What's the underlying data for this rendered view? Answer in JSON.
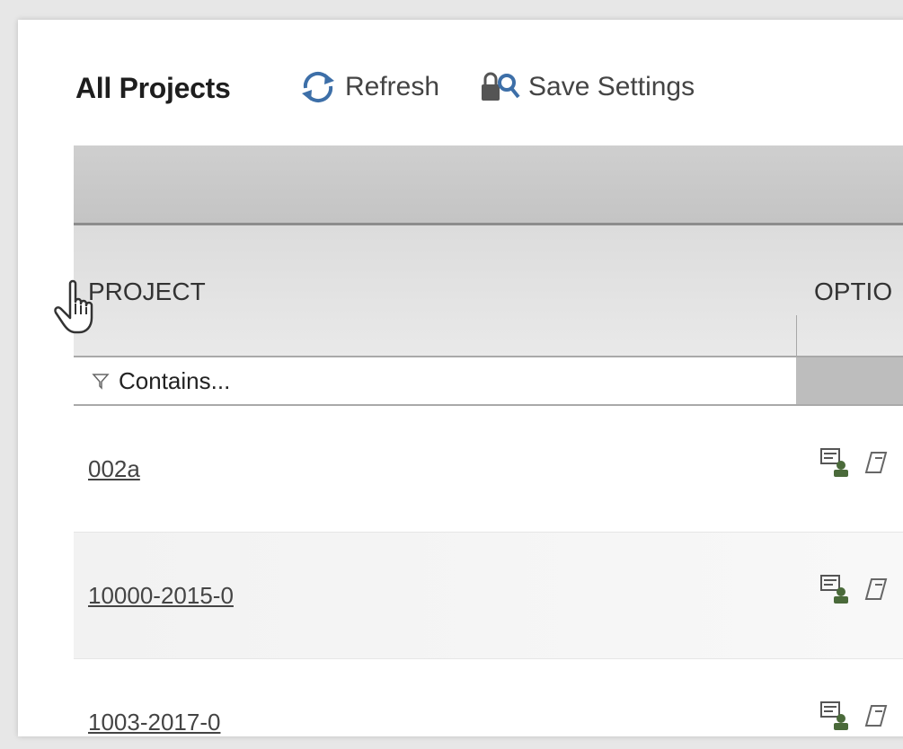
{
  "toolbar": {
    "title": "All Projects",
    "refresh_label": "Refresh",
    "refresh_icon": "refresh-icon",
    "save_label": "Save Settings",
    "save_icon": "save-settings-icon"
  },
  "grid": {
    "columns": [
      {
        "key": "project",
        "label": "PROJECT"
      },
      {
        "key": "options",
        "label": "OPTIO"
      }
    ],
    "filter": {
      "placeholder": "Contains...",
      "icon": "filter-icon"
    },
    "rows": [
      {
        "project": "002a",
        "options_icons": [
          "project-detail-icon",
          "edit-icon"
        ]
      },
      {
        "project": "10000-2015-0",
        "options_icons": [
          "project-detail-icon",
          "edit-icon"
        ]
      },
      {
        "project": "1003-2017-0",
        "options_icons": [
          "project-detail-icon",
          "edit-icon"
        ]
      }
    ]
  },
  "colors": {
    "header_bg": "#dcdcdc",
    "group_band": "#c8c8c8",
    "alt_row": "#f3f3f3",
    "text": "#444444",
    "accent_icon": "#4a6a3a"
  }
}
